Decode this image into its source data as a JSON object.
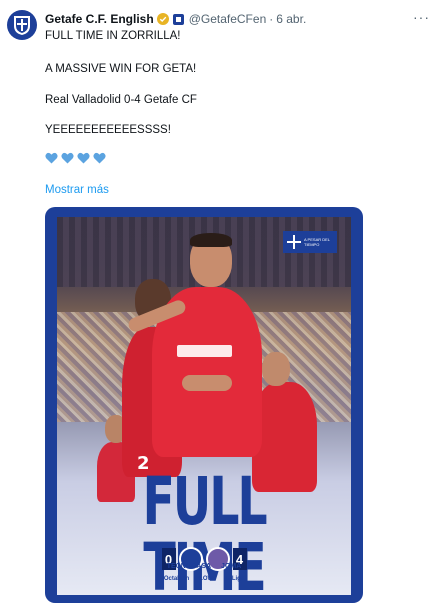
{
  "account": {
    "name": "Getafe C.F. English",
    "handle": "@GetafeCFen",
    "separator": "·",
    "time": "6 abr."
  },
  "tweet": {
    "lines": [
      "FULL TIME IN ZORRILLA!",
      "A MASSIVE WIN FOR GETA!",
      "Real Valladolid 0-4 Getafe CF",
      "YEEEEEEEEEEESSSS!"
    ],
    "hearts_count": 4,
    "heart_color": "#5ba3e0",
    "show_more": "Mostrar más"
  },
  "media": {
    "headline": "FULL TIME",
    "score_home": "0",
    "score_away": "4",
    "corner_badge_text": "A PESAR DEL TIEMPO",
    "player_number": "2",
    "sponsors_row1": [
      "TECNOCASA",
      "JOMA"
    ],
    "sponsors_row2": [
      "Octalsan",
      "LOWI",
      "LaLiga"
    ],
    "brand_color": "#1d3f99",
    "accent_red": "#e32a3a"
  },
  "icons": {
    "verified": "verified-badge-icon",
    "org": "org-affiliation-icon",
    "more": "more-options-icon"
  }
}
